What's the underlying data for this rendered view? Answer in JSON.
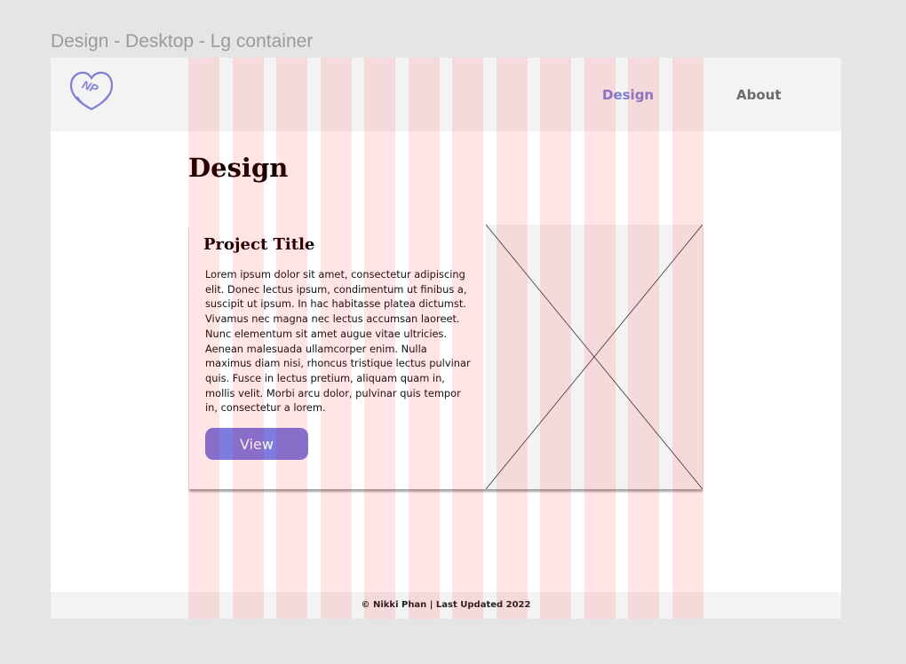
{
  "canvas": {
    "frame_label": "Design - Desktop - Lg container"
  },
  "header": {
    "logo": {
      "text": "NP",
      "color": "#7f7fd6"
    },
    "nav": [
      {
        "label": "Design",
        "active": true
      },
      {
        "label": "About",
        "active": false
      }
    ]
  },
  "main": {
    "page_title": "Design",
    "project": {
      "title": "Project Title",
      "body": "Lorem ipsum dolor sit amet, consectetur adipiscing elit. Donec lectus ipsum, condimentum ut finibus a, suscipit ut ipsum. In hac habitasse platea dictumst. Vivamus nec magna nec lectus accumsan laoreet. Nunc elementum sit amet augue vitae ultricies. Aenean malesuada ullamcorper enim. Nulla maximus diam nisi, rhoncus tristique lectus pulvinar quis. Fusce in lectus pretium, aliquam quam in, mollis velit. Morbi arcu dolor, pulvinar quis tempor in, consectetur a lorem.",
      "button_label": "View"
    }
  },
  "footer": {
    "text": "© Nikki Phan | Last Updated 2022"
  },
  "colors": {
    "accent": "#7f7fd6",
    "button": "#7b7be0",
    "header_bg": "#f3f3f3",
    "heading": "#150000",
    "grid_overlay": "rgba(255,0,0,0.1)"
  },
  "grid": {
    "columns": 12
  }
}
